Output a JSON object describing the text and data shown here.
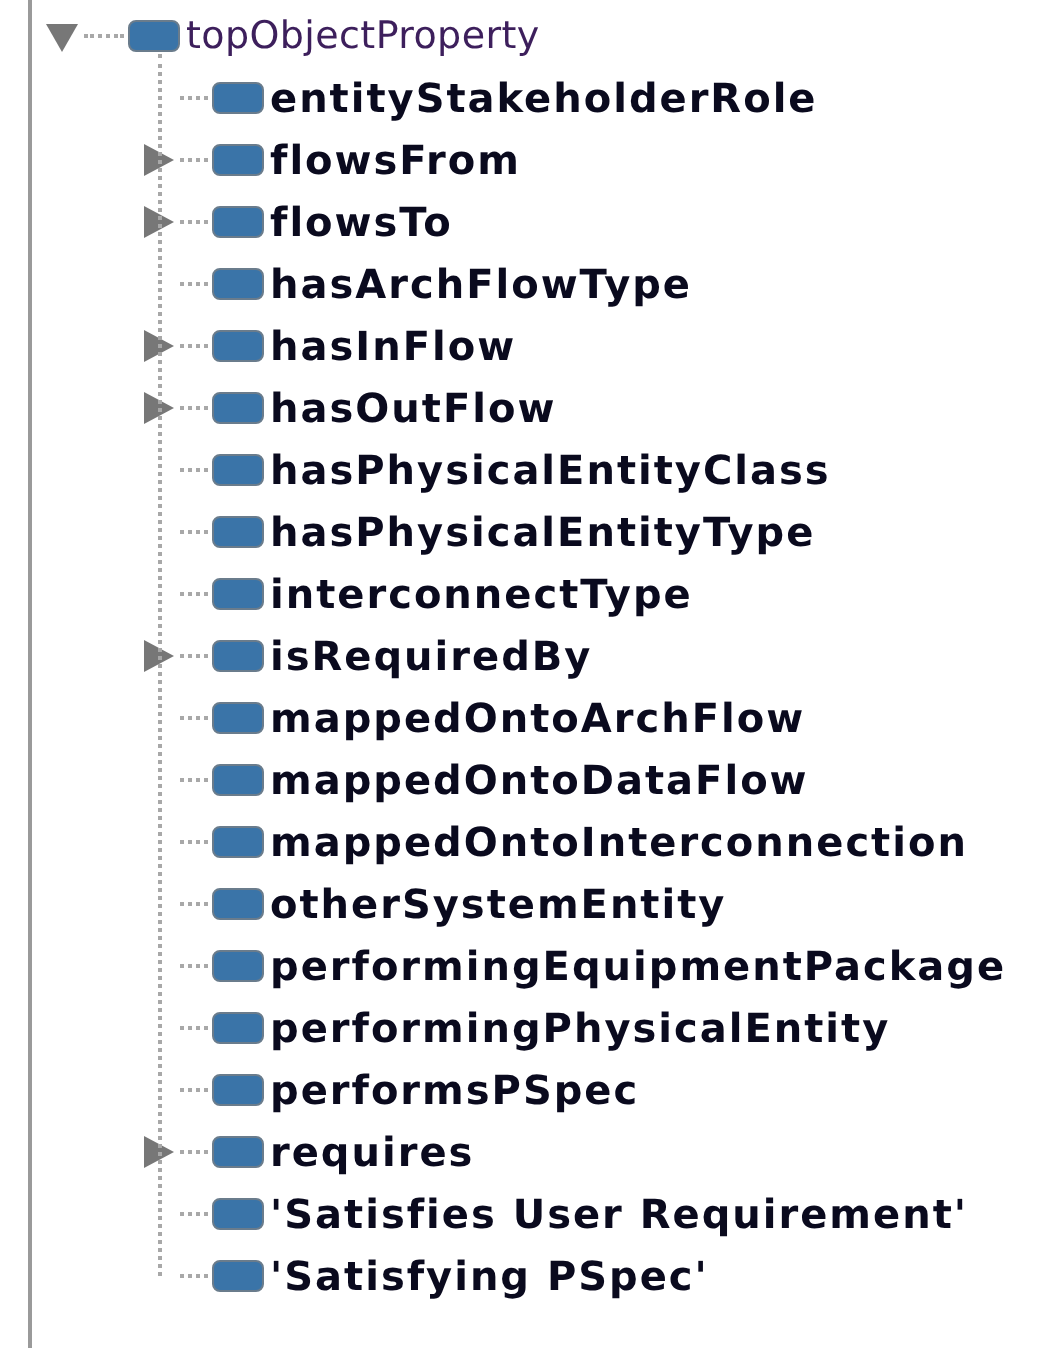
{
  "tree": {
    "label": "topObjectProperty",
    "expanded": true,
    "children": [
      {
        "label": "entityStakeholderRole",
        "expandable": false
      },
      {
        "label": "flowsFrom",
        "expandable": true,
        "expanded": false
      },
      {
        "label": "flowsTo",
        "expandable": true,
        "expanded": false
      },
      {
        "label": "hasArchFlowType",
        "expandable": false
      },
      {
        "label": "hasInFlow",
        "expandable": true,
        "expanded": false
      },
      {
        "label": "hasOutFlow",
        "expandable": true,
        "expanded": false
      },
      {
        "label": "hasPhysicalEntityClass",
        "expandable": false
      },
      {
        "label": "hasPhysicalEntityType",
        "expandable": false
      },
      {
        "label": "interconnectType",
        "expandable": false
      },
      {
        "label": "isRequiredBy",
        "expandable": true,
        "expanded": false
      },
      {
        "label": "mappedOntoArchFlow",
        "expandable": false
      },
      {
        "label": "mappedOntoDataFlow",
        "expandable": false
      },
      {
        "label": "mappedOntoInterconnection",
        "expandable": false
      },
      {
        "label": "otherSystemEntity",
        "expandable": false
      },
      {
        "label": "performingEquipmentPackage",
        "expandable": false
      },
      {
        "label": "performingPhysicalEntity",
        "expandable": false
      },
      {
        "label": "performsPSpec",
        "expandable": false
      },
      {
        "label": "requires",
        "expandable": true,
        "expanded": false
      },
      {
        "label": "'Satisfies User Requirement'",
        "expandable": false
      },
      {
        "label": "'Satisfying PSpec'",
        "expandable": false
      }
    ]
  }
}
